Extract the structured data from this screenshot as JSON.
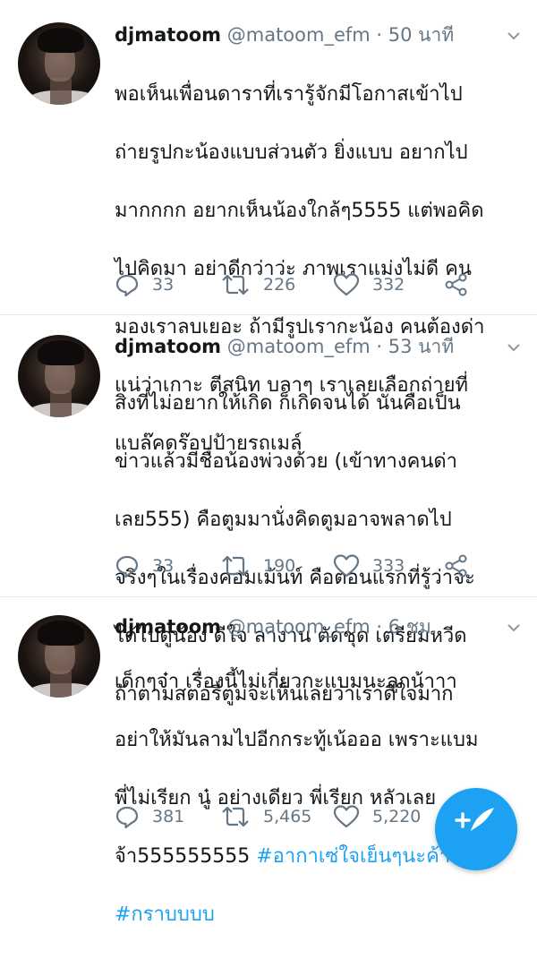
{
  "tweets": [
    {
      "name": "djmatoom",
      "handle": "@matoom_efm",
      "time": "· 50 นาที",
      "text_lines": [
        "พอเห็นเพื่อนดาราที่เรารู้จักมีโอกาสเข้าไป",
        "ถ่ายรูปกะน้องแบบส่วนตัว ยิ่งแบบ อยากไป",
        "มากกกก อยากเห็นน้องใกล้ๆ5555 แต่พอคิด",
        "ไปคิดมา อย่าดีกว่าว่ะ ภาพเราแม่งไม่ดี คน",
        "มองเราลบเยอะ ถ้ามีรูปเรากะน้อง คนต้องด่า",
        "แน่ว่าเกาะ ตีสนิท บลาๆ เราเลยเลือกถ่ายที่",
        "แบล๊คดร๊อปป้ายรถเมล์"
      ],
      "replies": "33",
      "retweets": "226",
      "likes": "332"
    },
    {
      "name": "djmatoom",
      "handle": "@matoom_efm",
      "time": "· 53 นาที",
      "text_lines": [
        "สิ่งที่ไม่อยากให้เกิด ก็เกิดจนได้ นั่นคือเป็น",
        "ข่าวแล้วมีชื่อน้องพ่วงด้วย (เข้าทางคนด่า",
        "เลย555) คือตูมมานั่งคิดตูมอาจพลาดไป",
        "จริงๆในเรื่องคอมเม้นท์ คือตอนแรกที่รู้ว่าจะ",
        "ได้ไปดูน้อง ดีใจ ลางาน ตัดชุด เตรียมหวีด",
        "ถ้าตามสตอรี่ตูมจะเห็นเลยว่าเราดีใจมาก"
      ],
      "replies": "33",
      "retweets": "190",
      "likes": "333"
    },
    {
      "name": "djmatoom",
      "handle": "@matoom_efm",
      "time": "· 6 ชม.",
      "text_lines": [
        "เด็กๆจ๋า เรื่องนี้ไม่เกี่ยวกะแบมนะลูกน้าาา",
        "อย่าให้มันลามไปอีกกระทู้เน้อออ เพราะแบม",
        "พี่ไม่เรียก นู๋ อย่างเดียว พี่เรียก หลัวเลย"
      ],
      "text_line4_plain": "จ้า555555555 ",
      "hashtag1": "#อากาเซ่ใจเย็นๆนะค้า",
      "hashtag2": "#กราบบบบ",
      "replies": "381",
      "retweets": "5,465",
      "likes": "5,220"
    }
  ],
  "icons": {
    "reply": "reply-icon",
    "retweet": "retweet-icon",
    "like": "heart-icon",
    "share": "share-icon",
    "menu": "chevron-down-icon",
    "compose": "compose-tweet-icon"
  },
  "colors": {
    "accent": "#1da1f2",
    "secondary_text": "#657786",
    "divider": "#e1e8ed"
  }
}
